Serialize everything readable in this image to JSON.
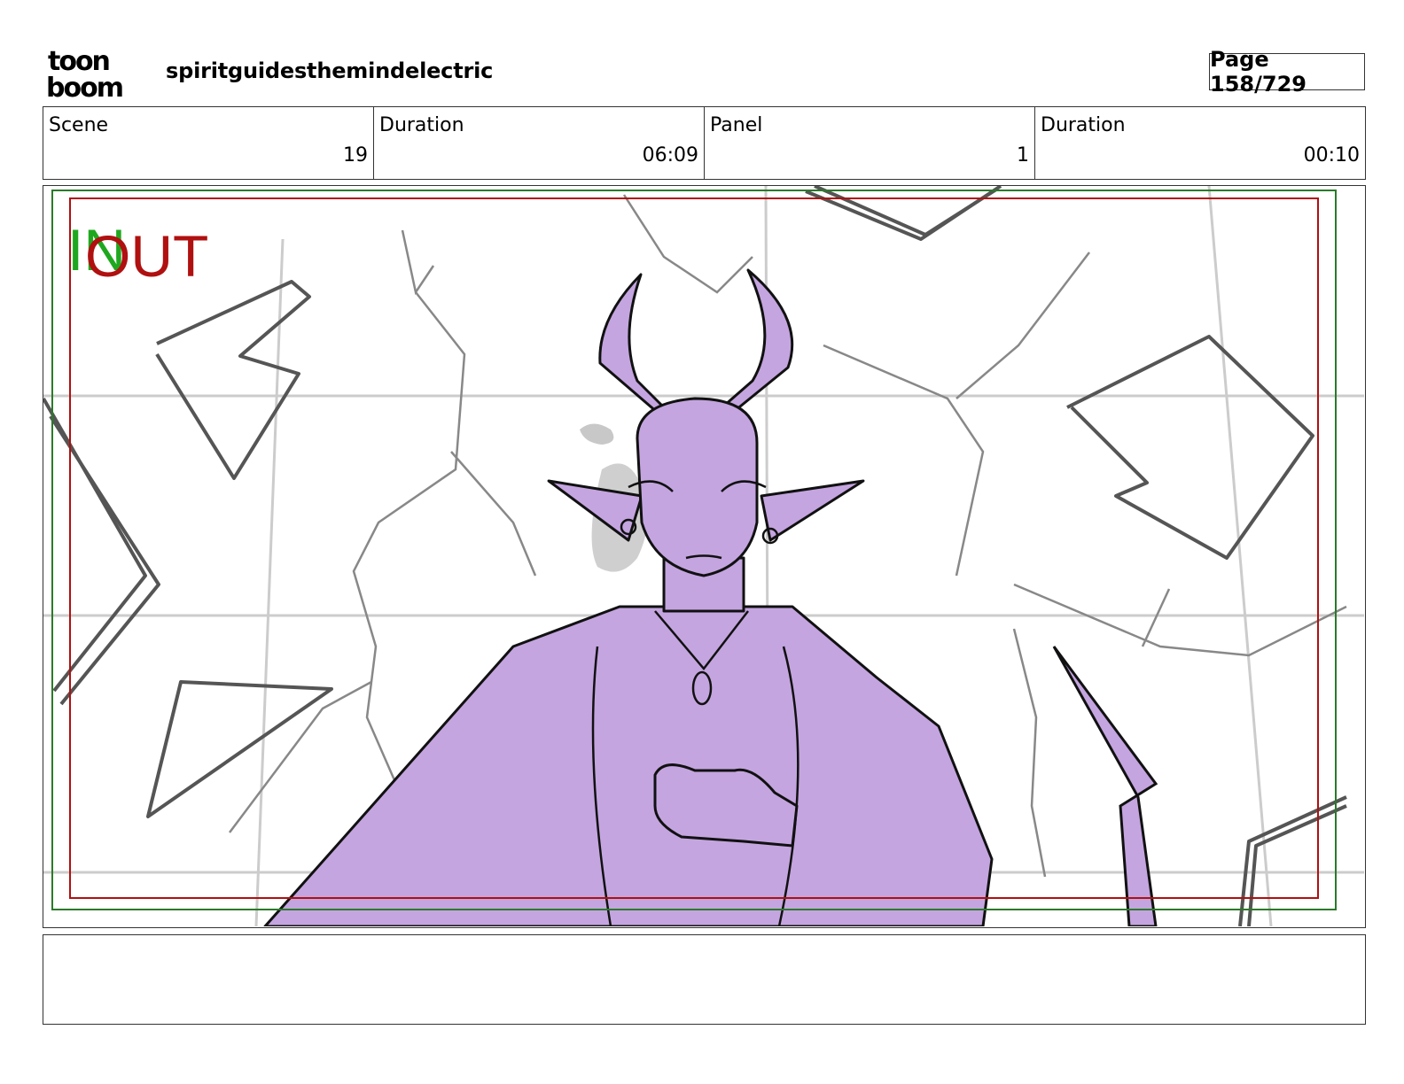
{
  "header": {
    "logo_text_top": "toon",
    "logo_text_bottom": "boom",
    "project_title": "spiritguidesthemindelectric",
    "page_label": "Page 158/729"
  },
  "info": {
    "scene_label": "Scene",
    "scene_value": "19",
    "scene_duration_label": "Duration",
    "scene_duration_value": "06:09",
    "panel_label": "Panel",
    "panel_value": "1",
    "panel_duration_label": "Duration",
    "panel_duration_value": "00:10"
  },
  "panel_overlay": {
    "in_label": "IN",
    "out_label": "OUT",
    "in_color": "#1fa81f",
    "out_color": "#b01010",
    "safe_frame_color": "#2a7a2a",
    "action_frame_color": "#b01010",
    "character_fill": "#c4a5e0"
  },
  "caption": {
    "text": ""
  }
}
